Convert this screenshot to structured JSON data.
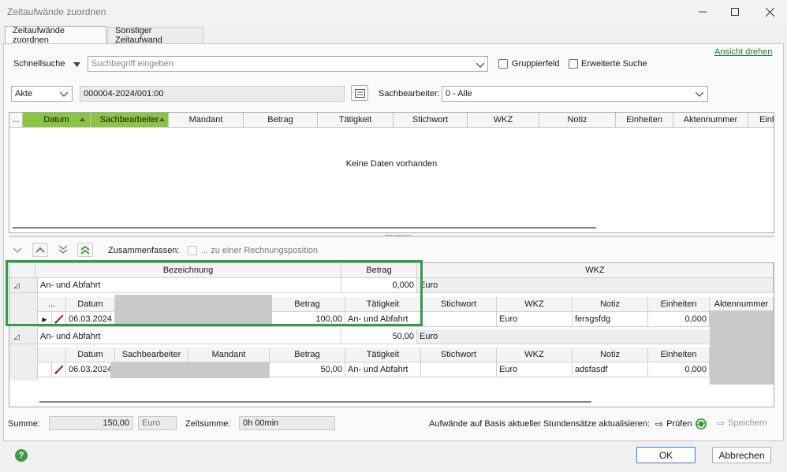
{
  "window": {
    "title": "Zeitaufwände zuordnen"
  },
  "tabs": [
    "Zeitaufwände zuordnen",
    "Sonstiger Zeitaufwand"
  ],
  "link_rotate": "Ansicht drehen",
  "search": {
    "label": "Schnellsuche",
    "placeholder": "Suchbegriff eingeben",
    "group_field": "Gruppierfeld",
    "extended": "Erweiterte Suche"
  },
  "file": {
    "type": "Akte",
    "number": "000004-2024/001:00",
    "clerk_label": "Sachbearbeiter:",
    "clerk_value": "0 - Alle"
  },
  "top_grid": {
    "columns": [
      "...",
      "Datum",
      "Sachbearbeiter",
      "Mandant",
      "Betrag",
      "Tätigkeit",
      "Stichwort",
      "WKZ",
      "Notiz",
      "Einheiten",
      "Aktennummer",
      "Einh"
    ],
    "empty_text": "Keine Daten vorhanden"
  },
  "merge": {
    "label": "Zusammenfassen:",
    "option": "... zu einer Rechnungsposition"
  },
  "bottom_grid": {
    "columns": [
      "Bezeichnung",
      "Betrag",
      "WKZ"
    ],
    "detail_columns": [
      "...",
      "Datum",
      "Sachbearbeiter",
      "Mandant",
      "Betrag",
      "Tätigkeit",
      "Stichwort",
      "WKZ",
      "Notiz",
      "Einheiten",
      "Aktennummer"
    ],
    "groups": [
      {
        "name": "An- und Abfahrt",
        "amount": "0,000",
        "currency": "Euro",
        "row": {
          "date": "06.03.2024",
          "amount": "100,00",
          "activity": "An- und Abfahrt",
          "currency": "Euro",
          "note": "fersgsfdg",
          "units": "0,000"
        }
      },
      {
        "name": "An- und Abfahrt",
        "amount": "50,00",
        "currency": "Euro",
        "row": {
          "date": "06.03.2024",
          "amount": "50,00",
          "activity": "An- und Abfahrt",
          "currency": "Euro",
          "note": "adsfasdf",
          "units": "0,000"
        }
      }
    ]
  },
  "footer": {
    "sum_label": "Summe:",
    "sum_value": "150,00",
    "sum_currency": "Euro",
    "time_label": "Zeitsumme:",
    "time_value": "0h 00min",
    "update_label": "Aufwände auf Basis aktueller Stundensätze aktualisieren:",
    "check_label": "Prüfen",
    "save_label": "Speichern"
  },
  "buttons": {
    "ok": "OK",
    "cancel": "Abbrechen"
  },
  "colors": {
    "accent_green": "#8ac440",
    "highlight_box": "#2e9e4a",
    "link": "#1e7d35"
  }
}
